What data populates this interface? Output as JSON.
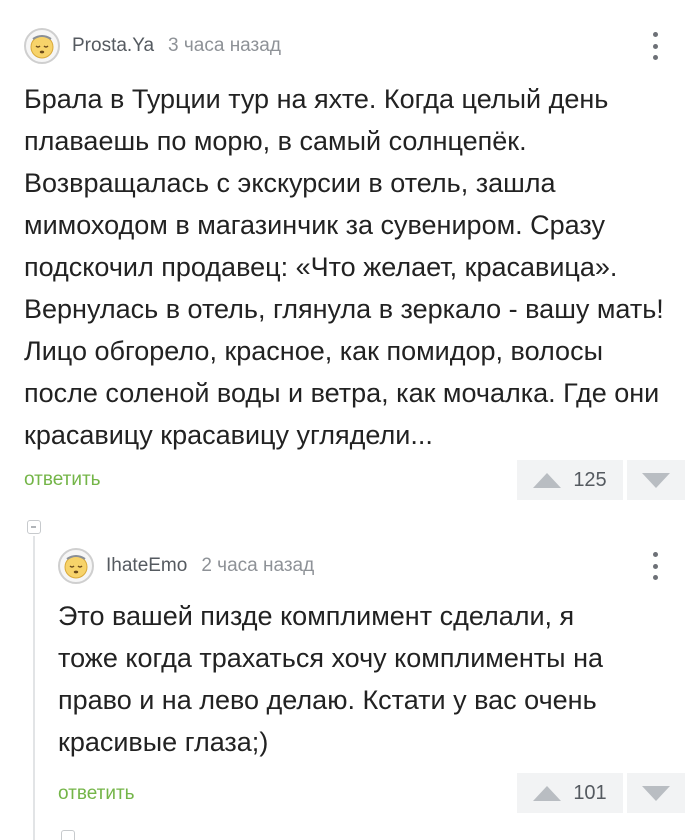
{
  "comments": [
    {
      "username": "Prosta.Ya",
      "timestamp": "3 часа назад",
      "avatar_icon": "avatar-sleepy-face-icon",
      "text": "Брала в Турции тур на яхте. Когда целый день\nплаваешь по морю, в самый солнцепёк.\nВозвращалась с экскурсии в отель, зашла\nмимоходом в магазинчик за сувениром. Сразу\nподскочил продавец: «Что желает, красавица».\nВернулась в отель, глянула в зеркало - вашу мать!\nЛицо обгорело, красное, как помидор, волосы\nпосле соленой воды и ветра, как мочалка. Где они\nкрасавицу красавицу углядели...",
      "reply_label": "ответить",
      "rating": "125"
    },
    {
      "username": "IhateEmo",
      "timestamp": "2 часа назад",
      "avatar_icon": "avatar-sleepy-face-icon",
      "text": "Это вашей пизде комплимент сделали, я\nтоже когда трахаться хочу комплименты на\nправо и на лево делаю. Кстати у вас очень\nкрасивые глаза;)",
      "reply_label": "ответить",
      "rating": "101"
    }
  ],
  "colors": {
    "link": "#74b548",
    "text": "#222222",
    "meta": "#8e9297",
    "vote_bg": "#f2f3f4"
  }
}
